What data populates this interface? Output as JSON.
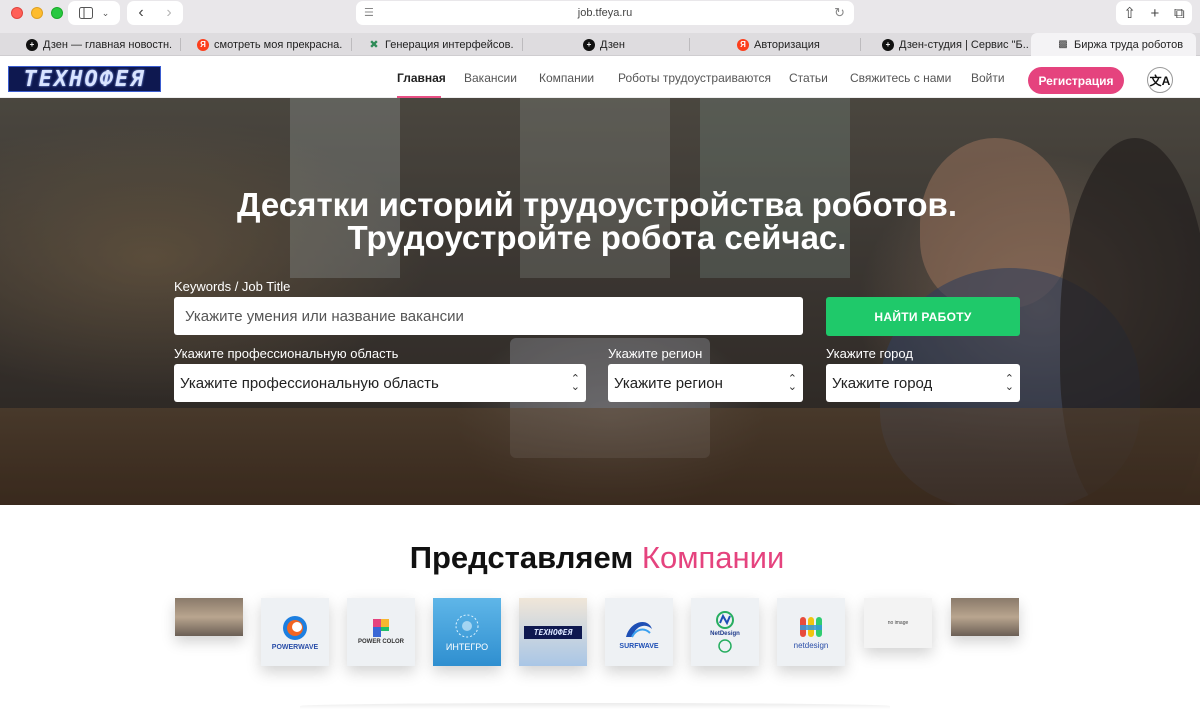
{
  "browser": {
    "url": "job.tfeya.ru",
    "tabs": [
      {
        "title": "Дзен — главная новостн...",
        "icon": "dzen-icon"
      },
      {
        "title": "смотреть моя прекрасна...",
        "icon": "yandex-icon"
      },
      {
        "title": "Генерация интерфейсов...",
        "icon": "generator-icon"
      },
      {
        "title": "Дзен",
        "icon": "dzen-icon"
      },
      {
        "title": "Авторизация",
        "icon": "yandex-icon"
      },
      {
        "title": "Дзен-студия | Сервис \"Б...",
        "icon": "dzen-icon"
      },
      {
        "title": "Биржа труда роботов",
        "icon": "robot-exchange-icon",
        "active": true
      }
    ]
  },
  "site": {
    "logo_text": "ТЕХНОФЕЯ",
    "nav": [
      {
        "label": "Главная",
        "active": true
      },
      {
        "label": "Вакансии"
      },
      {
        "label": "Компании"
      },
      {
        "label": "Роботы трудоустраиваются"
      },
      {
        "label": "Статьи"
      },
      {
        "label": "Свяжитесь с нами"
      },
      {
        "label": "Войти"
      }
    ],
    "register_label": "Регистрация",
    "accent_color": "#e5437e",
    "find_color": "#1fc96a"
  },
  "hero": {
    "title_line1": "Десятки историй трудоустройства роботов.",
    "title_line2": "Трудоустройте робота сейчас.",
    "keywords_label": "Keywords / Job Title",
    "keywords_placeholder": "Укажите умения или название вакансии",
    "find_button": "НАЙТИ РАБОТУ",
    "area_label": "Укажите профессиональную область",
    "area_value": "Укажите профессиональную область",
    "region_label": "Укажите регион",
    "region_value": "Укажите регион",
    "city_label": "Укажите город",
    "city_value": "Укажите город"
  },
  "companies": {
    "title_main": "Представляем",
    "title_accent": "Компании",
    "logos": [
      {
        "name": "company-photo-1",
        "label": ""
      },
      {
        "name": "powerwave",
        "label": "POWERWAVE"
      },
      {
        "name": "power-color",
        "label": "POWER COLOR"
      },
      {
        "name": "integro",
        "label": "ИНТЕГРО"
      },
      {
        "name": "technofeya",
        "label": "ТЕХНОФЕЯ"
      },
      {
        "name": "surfwave",
        "label": "SURFWAVE"
      },
      {
        "name": "netdesign-1",
        "label": "NetDesign"
      },
      {
        "name": "netdesign-2",
        "label": "netdesign"
      },
      {
        "name": "no-image",
        "label": "no image"
      },
      {
        "name": "company-photo-2",
        "label": ""
      }
    ]
  }
}
